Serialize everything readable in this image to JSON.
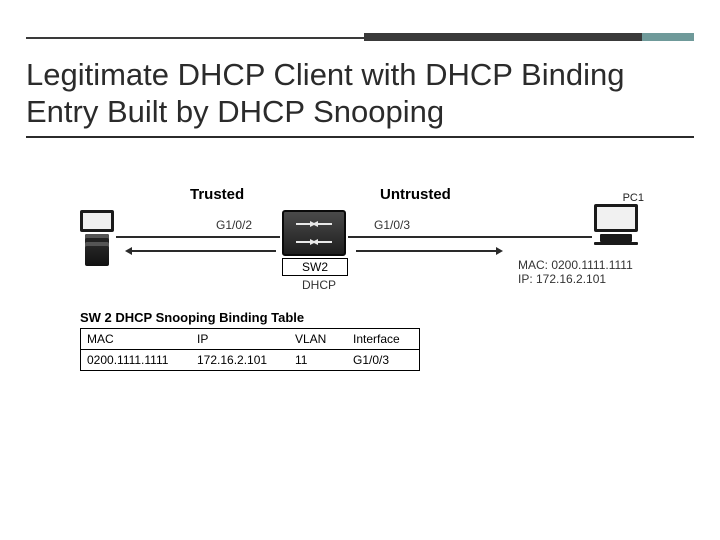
{
  "title": "Legitimate DHCP Client with DHCP Binding Entry Built by DHCP Snooping",
  "labels": {
    "trusted": "Trusted",
    "untrusted": "Untrusted",
    "port_left": "G1/0/2",
    "port_right": "G1/0/3",
    "switch_name": "SW2",
    "dhcp": "DHCP",
    "pc_name": "PC1",
    "pc_mac": "MAC: 0200.1111.1111",
    "pc_ip": "IP: 172.16.2.101"
  },
  "binding_table": {
    "title": "SW 2 DHCP Snooping Binding Table",
    "columns": [
      "MAC",
      "IP",
      "VLAN",
      "Interface"
    ],
    "rows": [
      [
        "0200.1111.1111",
        "172.16.2.101",
        "11",
        "G1/0/3"
      ]
    ]
  }
}
